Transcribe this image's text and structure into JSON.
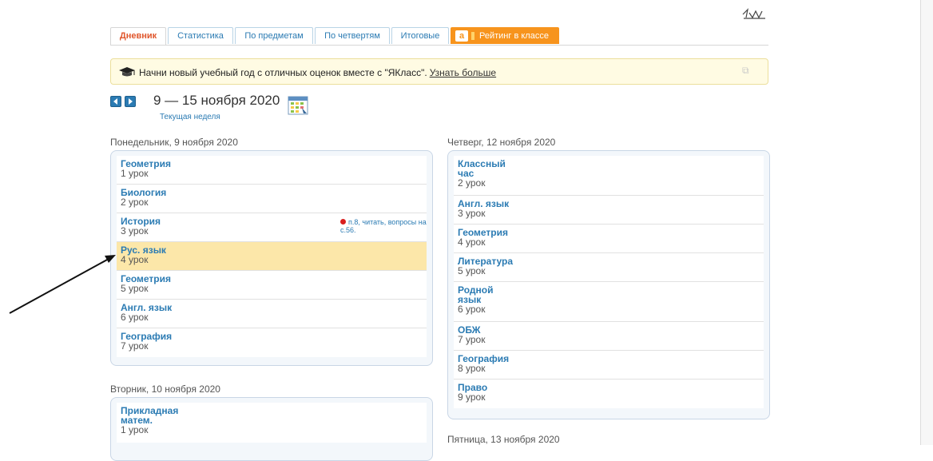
{
  "tabs": [
    {
      "label": "Дневник",
      "active": true
    },
    {
      "label": "Статистика"
    },
    {
      "label": "По предметам"
    },
    {
      "label": "По четвертям"
    },
    {
      "label": "Итоговые"
    },
    {
      "label": "Рейтинг в классе",
      "logo": "a"
    }
  ],
  "banner": {
    "text": "Начни новый учебный год с отличных оценок вместе с \"ЯКласс\".",
    "link": "Узнать больше",
    "icon": "graduation-cap-icon"
  },
  "week": {
    "range": "9 — 15 ноября 2020",
    "current_label": "Текущая неделя",
    "prev_icon": "arrow-left-icon",
    "next_icon": "arrow-right-icon",
    "calendar_icon": "calendar-icon"
  },
  "days": {
    "monday": {
      "title": "Понедельник, 9 ноября 2020",
      "lessons": [
        {
          "subject": "Геометрия",
          "number": "1 урок"
        },
        {
          "subject": "Биология",
          "number": "2 урок"
        },
        {
          "subject": "История",
          "number": "3 урок",
          "homework": "п.8, читать, вопросы на с.56."
        },
        {
          "subject": "Рус. язык",
          "number": "4 урок"
        },
        {
          "subject": "Геометрия",
          "number": "5 урок"
        },
        {
          "subject": "Англ. язык",
          "number": "6 урок"
        },
        {
          "subject": "География",
          "number": "7 урок"
        }
      ]
    },
    "tuesday": {
      "title": "Вторник, 10 ноября 2020",
      "lessons": [
        {
          "subject": "Прикладная матем.",
          "number": "1 урок"
        }
      ]
    },
    "thursday": {
      "title": "Четверг, 12 ноября 2020",
      "lessons": [
        {
          "subject": "Классный час",
          "number": "2 урок"
        },
        {
          "subject": "Англ. язык",
          "number": "3 урок"
        },
        {
          "subject": "Геометрия",
          "number": "4 урок"
        },
        {
          "subject": "Литература",
          "number": "5 урок"
        },
        {
          "subject": "Родной язык",
          "number": "6 урок"
        },
        {
          "subject": "ОБЖ",
          "number": "7 урок"
        },
        {
          "subject": "География",
          "number": "8 урок"
        },
        {
          "subject": "Право",
          "number": "9 урок"
        }
      ]
    },
    "friday": {
      "title": "Пятница, 13 ноября 2020"
    }
  },
  "colors": {
    "link": "#2b7bb3",
    "active_tab": "#e0562c",
    "rating_tab": "#f7941d",
    "highlight": "#fce7a9",
    "homework_dot": "#d91f1f"
  }
}
